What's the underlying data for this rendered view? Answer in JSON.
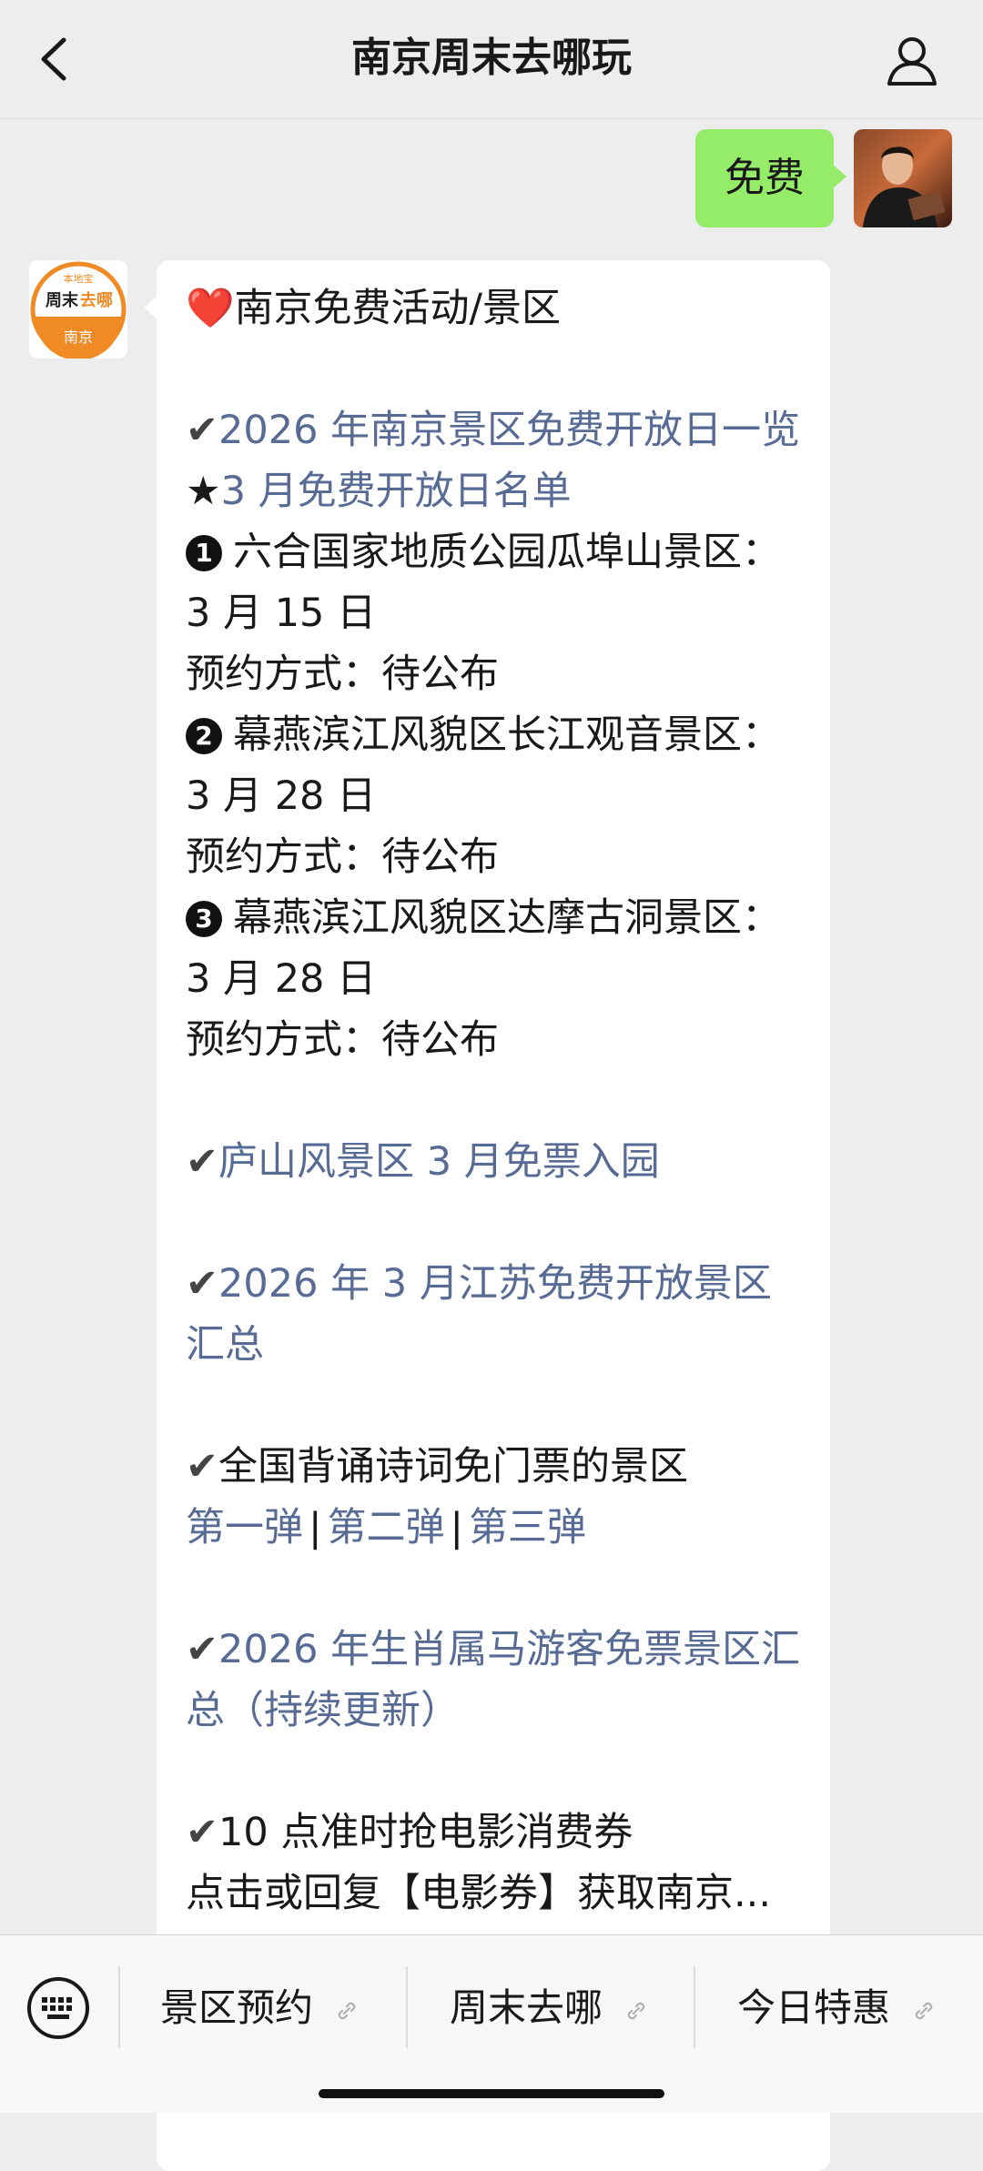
{
  "header": {
    "title": "南京周末去哪玩"
  },
  "outgoing": {
    "text": "免费"
  },
  "message": {
    "heading_icon": "❤️",
    "heading": "南京免费活动/景区",
    "check": "✔",
    "link_2026_free_days": "2026 年南京景区免费开放日一览",
    "star": "★",
    "march_list": "3 月免费开放日名单",
    "item1_badge": "1",
    "item1_title": "六合国家地质公园瓜埠山景区：",
    "item1_date": "3 月 15 日",
    "item1_booking": "预约方式：待公布",
    "item2_badge": "2",
    "item2_title": "幕燕滨江风貌区长江观音景区：",
    "item2_date": "3 月 28 日",
    "item2_booking": "预约方式：待公布",
    "item3_badge": "3",
    "item3_title": "幕燕滨江风貌区达摩古洞景区：",
    "item3_date": "3 月 28 日",
    "item3_booking": "预约方式：待公布",
    "link_lushan": "庐山风景区 3 月免票入园",
    "link_jiangsu": "2026 年 3 月江苏免费开放景区汇总",
    "poetry_text": "全国背诵诗词免门票的景区",
    "poetry_link1": "第一弹",
    "poetry_sep1": "|",
    "poetry_link2": "第二弹",
    "poetry_sep2": "|",
    "poetry_link3": "第三弹",
    "link_zodiac": "2026 年生肖属马游客免票景区汇总（持续更新）",
    "movie_text": "10 点准时抢电影消费券",
    "cut_text": "点击或回复【电影券】获取南京..."
  },
  "account_avatar": {
    "top_text": "本地宝",
    "mid_text_a": "周末",
    "mid_text_b": "去哪",
    "bottom_text": "南京"
  },
  "bottom_menu": {
    "items": [
      "景区预约",
      "周末去哪",
      "今日特惠"
    ]
  },
  "colors": {
    "link": "#576b95",
    "bubble_green": "#95ec69",
    "avatar_orange": "#f08a24"
  }
}
